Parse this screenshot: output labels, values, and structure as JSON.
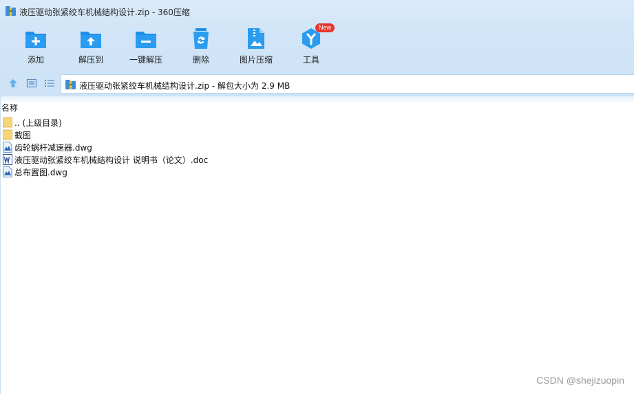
{
  "window": {
    "title": "液压驱动张紧绞车机械结构设计.zip - 360压缩",
    "app_icon": "archive-icon"
  },
  "toolbar": {
    "items": [
      {
        "label": "添加",
        "icon": "add-folder-icon"
      },
      {
        "label": "解压到",
        "icon": "extract-to-icon"
      },
      {
        "label": "一键解压",
        "icon": "one-click-extract-icon"
      },
      {
        "label": "删除",
        "icon": "recycle-bin-icon"
      },
      {
        "label": "图片压缩",
        "icon": "image-compress-icon"
      },
      {
        "label": "工具",
        "icon": "tools-icon",
        "badge": "New"
      }
    ]
  },
  "navbar": {
    "address": "液压驱动张紧绞车机械结构设计.zip - 解包大小为 2.9 MB"
  },
  "list": {
    "column_name": "名称",
    "rows": [
      {
        "name": ".. (上级目录)",
        "type": "folder"
      },
      {
        "name": "截图",
        "type": "folder"
      },
      {
        "name": "齿轮蜗杆减速器.dwg",
        "type": "dwg"
      },
      {
        "name": "液压驱动张紧绞车机械结构设计 说明书（论文）.doc",
        "type": "doc"
      },
      {
        "name": "总布置图.dwg",
        "type": "dwg"
      }
    ]
  },
  "watermark": "CSDN @shejizuopin",
  "colors": {
    "accent": "#1e90e6",
    "toolbar_bg": "#d3e6f8",
    "badge": "#e8352f"
  }
}
